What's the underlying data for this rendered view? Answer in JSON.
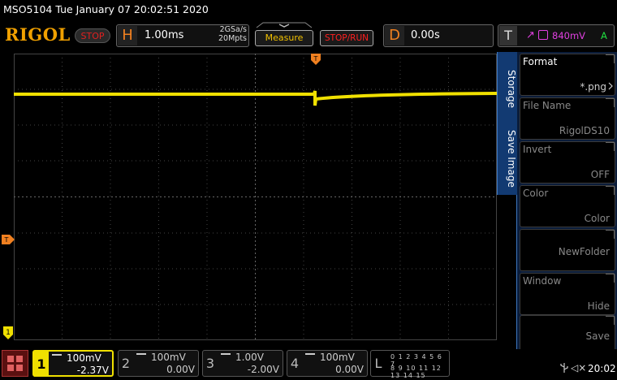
{
  "titlebar": {
    "text": "MSO5104  Tue January 07 20:02:51 2020"
  },
  "header": {
    "logo": "RIGOL",
    "run_state": "STOP",
    "horizontal": {
      "letter": "H",
      "timebase": "1.00ms",
      "sample_rate": "2GSa/s",
      "memory_depth": "20Mpts"
    },
    "measure_label": "Measure",
    "stoprun_label": "STOP/RUN",
    "delay": {
      "letter": "D",
      "value": "0.00s"
    },
    "trigger": {
      "letter": "T",
      "slope": "↗",
      "level": "840mV",
      "mode": "A"
    }
  },
  "markers": {
    "trigger_position": "T",
    "trigger_level": "T",
    "ch1_ground": "1"
  },
  "sidemenu": {
    "tabs": [
      "Storage",
      "Save Image"
    ],
    "items": [
      {
        "title": "Format",
        "value": "*.png",
        "enabled": true
      },
      {
        "title": "File Name",
        "value": "RigolDS10",
        "enabled": false
      },
      {
        "title": "Invert",
        "value": "OFF",
        "enabled": false
      },
      {
        "title": "Color",
        "value": "Color",
        "enabled": true
      },
      {
        "title": "",
        "value": "NewFolder",
        "enabled": false
      },
      {
        "title": "Window",
        "value": "Hide",
        "enabled": false
      },
      {
        "title": "",
        "value": "Save",
        "enabled": false
      }
    ]
  },
  "channels": [
    {
      "num": "1",
      "scale": "100mV",
      "offset": "-2.37V",
      "active": true
    },
    {
      "num": "2",
      "scale": "100mV",
      "offset": "0.00V",
      "active": false
    },
    {
      "num": "3",
      "scale": "1.00V",
      "offset": "-2.00V",
      "active": false
    },
    {
      "num": "4",
      "scale": "100mV",
      "offset": "0.00V",
      "active": false
    }
  ],
  "logic_analyzer": {
    "letter": "L",
    "row1": "0 1 2 3  4 5 6 7",
    "row2": "8 9 10 11 12 13 14 15"
  },
  "status": {
    "speaker": "◁×",
    "clock": "20:02"
  },
  "colors": {
    "ch1": "#f0e000",
    "accent": "#f08020",
    "trigger": "#e040e0",
    "menu": "#123a72"
  }
}
